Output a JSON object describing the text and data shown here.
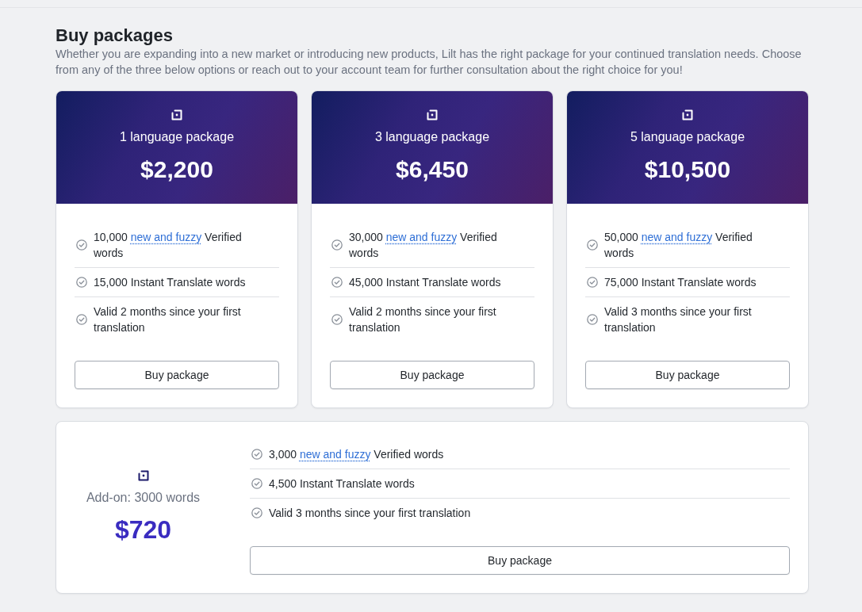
{
  "page": {
    "title": "Buy packages",
    "description": "Whether you are expanding into a new market or introducing new products, Lilt has the right package for your continued translation needs. Choose from any of the three below options or reach out to your account team for further consultation about the right choice for you!"
  },
  "packages": [
    {
      "name": "1 language package",
      "price": "$2,200",
      "features": [
        {
          "segments": [
            {
              "kind": "text",
              "text": "10,000"
            },
            {
              "kind": "link",
              "text": "new and fuzzy"
            },
            {
              "kind": "text",
              "text": "Verified words"
            }
          ]
        },
        {
          "segments": [
            {
              "kind": "text",
              "text": "15,000 Instant Translate words"
            }
          ]
        },
        {
          "segments": [
            {
              "kind": "text",
              "text": "Valid 2 months since your first translation"
            }
          ]
        }
      ],
      "button": "Buy package"
    },
    {
      "name": "3 language package",
      "price": "$6,450",
      "features": [
        {
          "segments": [
            {
              "kind": "text",
              "text": "30,000"
            },
            {
              "kind": "link",
              "text": "new and fuzzy"
            },
            {
              "kind": "text",
              "text": "Verified words"
            }
          ]
        },
        {
          "segments": [
            {
              "kind": "text",
              "text": "45,000 Instant Translate words"
            }
          ]
        },
        {
          "segments": [
            {
              "kind": "text",
              "text": "Valid 2 months since your first translation"
            }
          ]
        }
      ],
      "button": "Buy package"
    },
    {
      "name": "5 language package",
      "price": "$10,500",
      "features": [
        {
          "segments": [
            {
              "kind": "text",
              "text": "50,000"
            },
            {
              "kind": "link",
              "text": "new and fuzzy"
            },
            {
              "kind": "text",
              "text": "Verified words"
            }
          ]
        },
        {
          "segments": [
            {
              "kind": "text",
              "text": "75,000 Instant Translate words"
            }
          ]
        },
        {
          "segments": [
            {
              "kind": "text",
              "text": "Valid 3 months since your first translation"
            }
          ]
        }
      ],
      "button": "Buy package"
    }
  ],
  "addon": {
    "name": "Add-on: 3000 words",
    "price": "$720",
    "features": [
      {
        "segments": [
          {
            "kind": "text",
            "text": "3,000"
          },
          {
            "kind": "link",
            "text": "new and fuzzy"
          },
          {
            "kind": "text",
            "text": "Verified words"
          }
        ]
      },
      {
        "segments": [
          {
            "kind": "text",
            "text": "4,500 Instant Translate words"
          }
        ]
      },
      {
        "segments": [
          {
            "kind": "text",
            "text": "Valid 3 months since your first translation"
          }
        ]
      }
    ],
    "button": "Buy package"
  }
}
